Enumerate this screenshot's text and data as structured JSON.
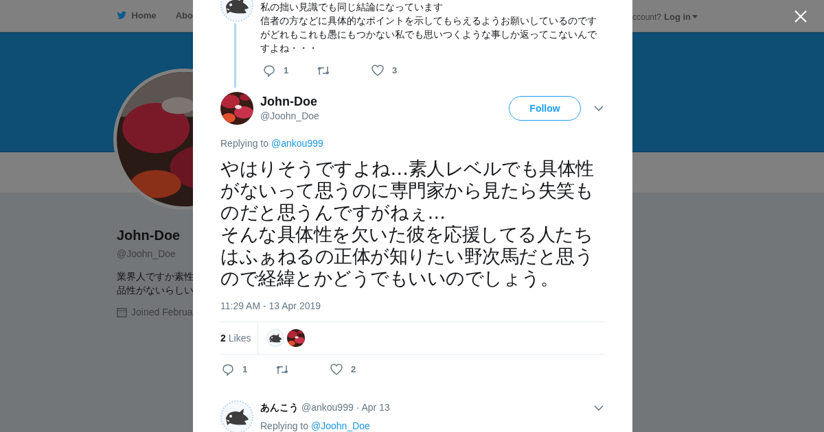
{
  "top_nav": {
    "items": [
      "Home",
      "Abo"
    ],
    "account_prompt": "ccount?",
    "login": "Log in"
  },
  "profile": {
    "name": "John-Doe",
    "handle": "@Joohn_Doe",
    "bio": [
      "業界人ですか素性",
      "品性がないらしい"
    ],
    "joined": "Joined Februa"
  },
  "modal": {
    "previous_tweet": {
      "lines": [
        "私の拙い見識でも同じ結論になっています",
        "信者の方などに具体的なポイントを示してもらえるようお願いしているのです",
        "がどれもこれも愚にもつかない私でも思いつくような事しか返ってこないんで",
        "すよね・・・"
      ],
      "replies": "1",
      "likes": "3"
    },
    "tweet": {
      "name": "John-Doe",
      "handle": "@Joohn_Doe",
      "follow": "Follow",
      "replying_prefix": "Replying to",
      "replying_to": "@ankou999",
      "text": "やはりそうですよね…素人レベルでも具体性がないって思うのに専門家から見たら失笑ものだと思うんですがねぇ…\nそんな具体性を欠いた彼を応援してる人たちはふぁねるの正体が知りたい野次馬だと思うので経緯とかどうでもいいのでしょう。",
      "timestamp": "11:29 AM - 13 Apr 2019",
      "like_count": "2",
      "likes_label": "Likes",
      "replies": "1",
      "likes": "2"
    },
    "reply": {
      "name": "あんこう",
      "handle": "@ankou999",
      "date": "· Apr 13",
      "replying_prefix": "Replying to",
      "replying_to": "@Joohn_Doe"
    }
  }
}
